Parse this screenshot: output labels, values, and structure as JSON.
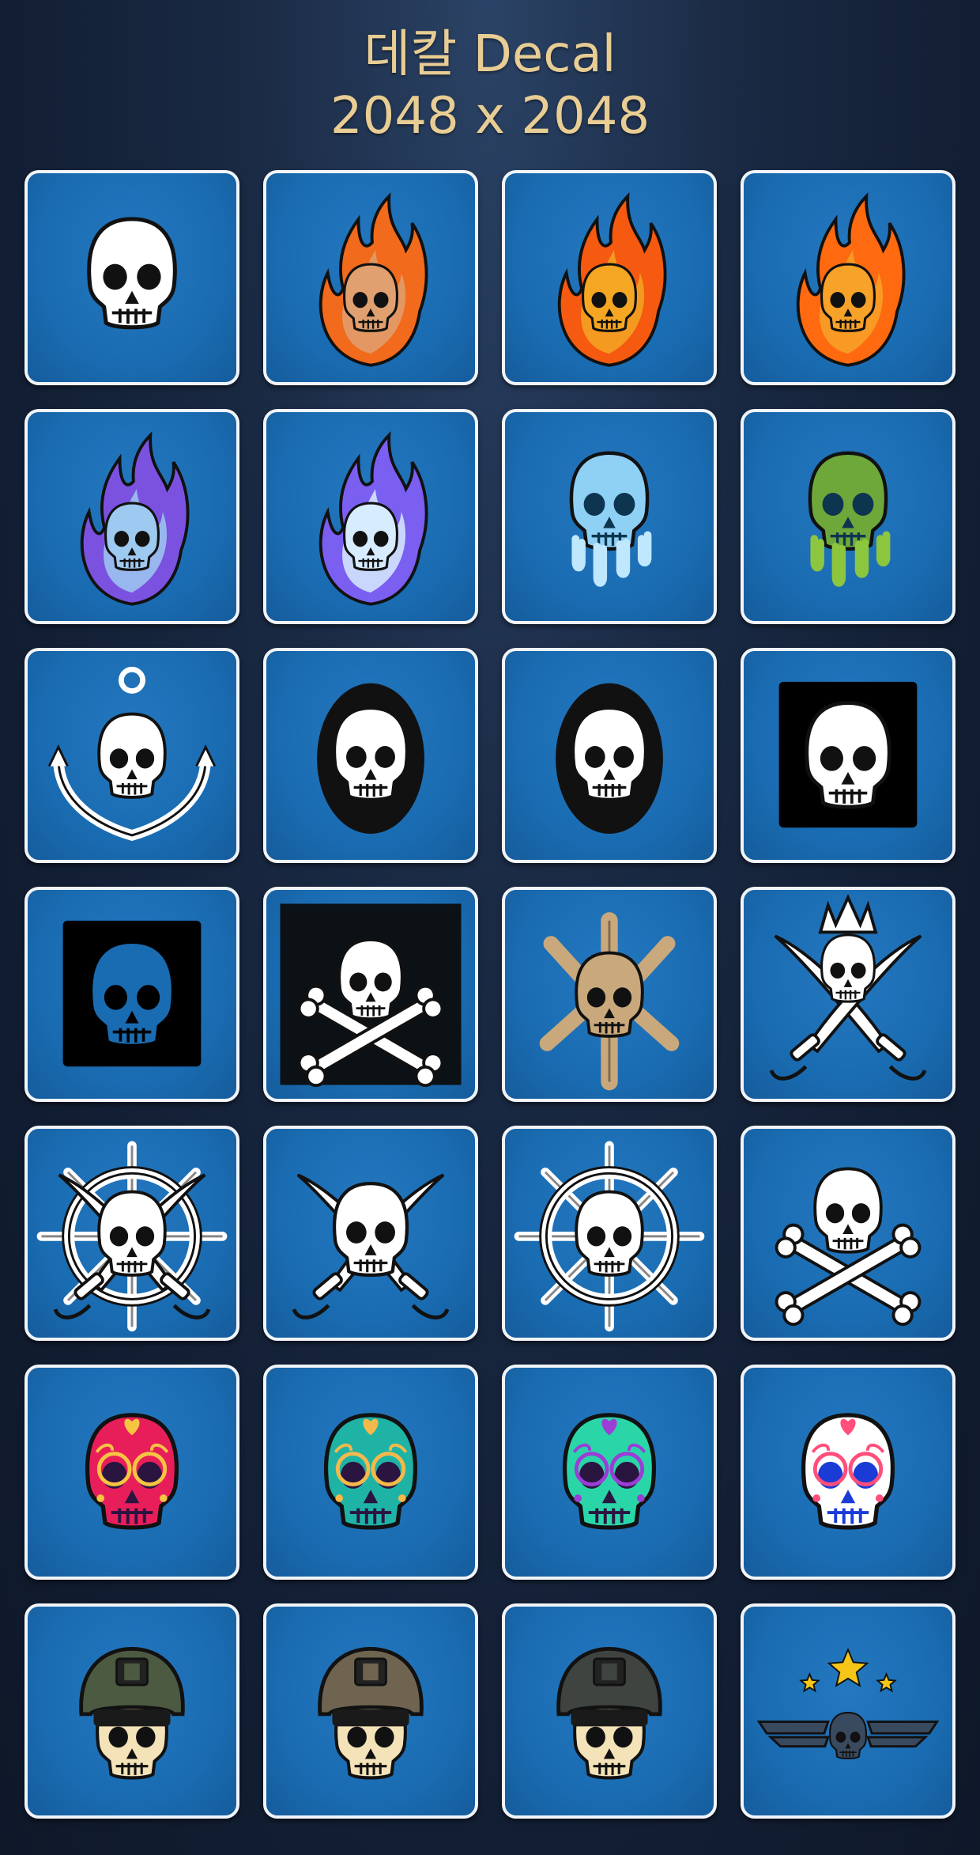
{
  "header": {
    "title": "데칼 Decal",
    "size": "2048 x 2048"
  },
  "decals": [
    {
      "id": 1,
      "icon": "screaming-skull-icon",
      "v": "plain",
      "c": "#ffffff"
    },
    {
      "id": 2,
      "icon": "flaming-screaming-skull-icon",
      "v": "flames",
      "c": "#e0a070",
      "f": "#f26a1b"
    },
    {
      "id": 3,
      "icon": "fire-skull-icon",
      "v": "flames",
      "c": "#f5a623",
      "f": "#f55a10"
    },
    {
      "id": 4,
      "icon": "fire-skull-icon",
      "v": "flames",
      "c": "#f7a228",
      "f": "#ff6a10"
    },
    {
      "id": 5,
      "icon": "purple-flame-skull-icon",
      "v": "flames",
      "c": "#9ec9f0",
      "f": "#7b52e0"
    },
    {
      "id": 6,
      "icon": "purple-flame-skull-icon",
      "v": "flames",
      "c": "#d8ecff",
      "f": "#7a5ff0"
    },
    {
      "id": 7,
      "icon": "ice-skull-icon",
      "v": "drip",
      "c": "#8fd0f5",
      "f": "#bfe8ff"
    },
    {
      "id": 8,
      "icon": "green-slime-skull-icon",
      "v": "drip",
      "c": "#6fa83a",
      "f": "#8cc63f"
    },
    {
      "id": 9,
      "icon": "anchor-skull-icon",
      "v": "anchor",
      "c": "#ffffff"
    },
    {
      "id": 10,
      "icon": "grunge-skull-icon",
      "v": "grunge",
      "c": "#ffffff"
    },
    {
      "id": 11,
      "icon": "grunge-skull-icon",
      "v": "grunge",
      "c": "#ffffff"
    },
    {
      "id": 12,
      "icon": "skull-black-square-icon",
      "v": "square",
      "c": "#ffffff",
      "f": "#000000"
    },
    {
      "id": 13,
      "icon": "skull-silhouette-square-icon",
      "v": "square",
      "c": "#1a6cb2",
      "f": "#000000"
    },
    {
      "id": 14,
      "icon": "jolly-roger-flag-icon",
      "v": "square-bones",
      "c": "#ffffff",
      "f": "#0c1116"
    },
    {
      "id": 15,
      "icon": "spiked-helmet-skull-icon",
      "v": "spikes",
      "c": "#c9a87c"
    },
    {
      "id": 16,
      "icon": "crowned-skull-swords-icon",
      "v": "crown-swords",
      "c": "#ffffff"
    },
    {
      "id": 17,
      "icon": "skull-wheel-swords-icon",
      "v": "wheel-swords",
      "c": "#ffffff"
    },
    {
      "id": 18,
      "icon": "skull-crossed-swords-icon",
      "v": "swords",
      "c": "#ffffff"
    },
    {
      "id": 19,
      "icon": "skull-ship-wheel-icon",
      "v": "wheel",
      "c": "#ffffff"
    },
    {
      "id": 20,
      "icon": "skull-crossbones-icon",
      "v": "crossbones",
      "c": "#ffffff"
    },
    {
      "id": 21,
      "icon": "pink-sugar-skull-icon",
      "v": "sugar",
      "c": "#e81e5a",
      "f": "#f5c542"
    },
    {
      "id": 22,
      "icon": "teal-sugar-skull-icon",
      "v": "sugar",
      "c": "#1fb3a6",
      "f": "#f5b94a"
    },
    {
      "id": 23,
      "icon": "neon-sugar-skull-icon",
      "v": "sugar",
      "c": "#2ad6a8",
      "f": "#9b3dd6"
    },
    {
      "id": 24,
      "icon": "white-sugar-skull-icon",
      "v": "sugar",
      "c": "#ffffff",
      "f": "#ff4f7a"
    },
    {
      "id": 25,
      "icon": "military-helmet-skull-icon",
      "v": "helmet",
      "c": "#f4e2b8",
      "f": "#4d5a42"
    },
    {
      "id": 26,
      "icon": "military-helmet-skull-icon",
      "v": "helmet",
      "c": "#f4e2b8",
      "f": "#6e6450"
    },
    {
      "id": 27,
      "icon": "military-helmet-skull-icon",
      "v": "helmet",
      "c": "#f4e2b8",
      "f": "#3f4440"
    },
    {
      "id": 28,
      "icon": "winged-skull-stars-icon",
      "v": "wings",
      "c": "#3a4a5e",
      "f": "#f5c518"
    }
  ]
}
